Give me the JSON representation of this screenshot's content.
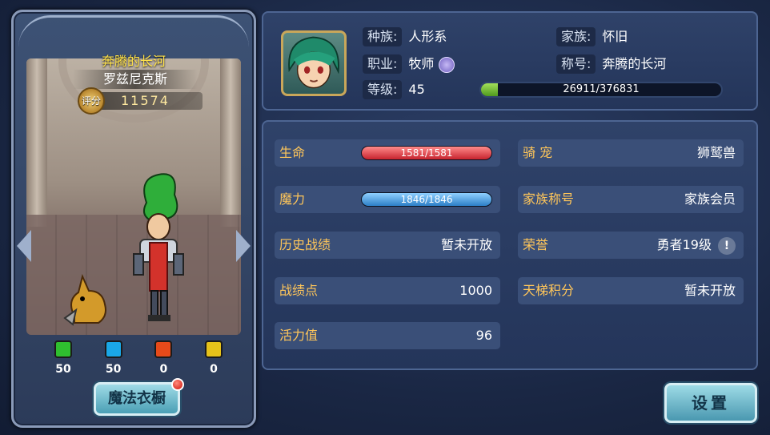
{
  "character": {
    "title": "奔腾的长河",
    "name": "罗兹尼克斯",
    "score_label": "评分",
    "score": "11574"
  },
  "gems": [
    {
      "color": "#2fbf2f",
      "value": "50",
      "name": "green-gem"
    },
    {
      "color": "#1aa7e6",
      "value": "50",
      "name": "blue-gem"
    },
    {
      "color": "#e64a1a",
      "value": "0",
      "name": "red-gem"
    },
    {
      "color": "#e6c21a",
      "value": "0",
      "name": "yellow-gem"
    }
  ],
  "wardrobe_label": "魔法衣橱",
  "info": {
    "race_label": "种族:",
    "race": "人形系",
    "class_label": "职业:",
    "class": "牧师",
    "level_label": "等级:",
    "level": "45",
    "family_label": "家族:",
    "family": "怀旧",
    "title_label": "称号:",
    "title": "奔腾的长河",
    "exp_text": "26911/376831",
    "exp_progress": 0.0714
  },
  "stats": {
    "hp_label": "生命",
    "hp": "1581/1581",
    "mp_label": "魔力",
    "mp": "1846/1846",
    "history_label": "历史战绩",
    "history": "暂未开放",
    "points_label": "战绩点",
    "points": "1000",
    "vitality_label": "活力值",
    "vitality": "96",
    "pet_label": "骑 宠",
    "pet": "狮鹫兽",
    "family_rank_label": "家族称号",
    "family_rank": "家族会员",
    "honor_label": "荣誉",
    "honor": "勇者19级",
    "ladder_label": "天梯积分",
    "ladder": "暂未开放"
  },
  "settings_label": "设置",
  "colors": {
    "accent_text": "#ffc65a",
    "title_yellow": "#ffe24a",
    "hp_red": "#c6232e",
    "mp_blue": "#2d7fc7",
    "exp_green": "#4f9a1e"
  }
}
